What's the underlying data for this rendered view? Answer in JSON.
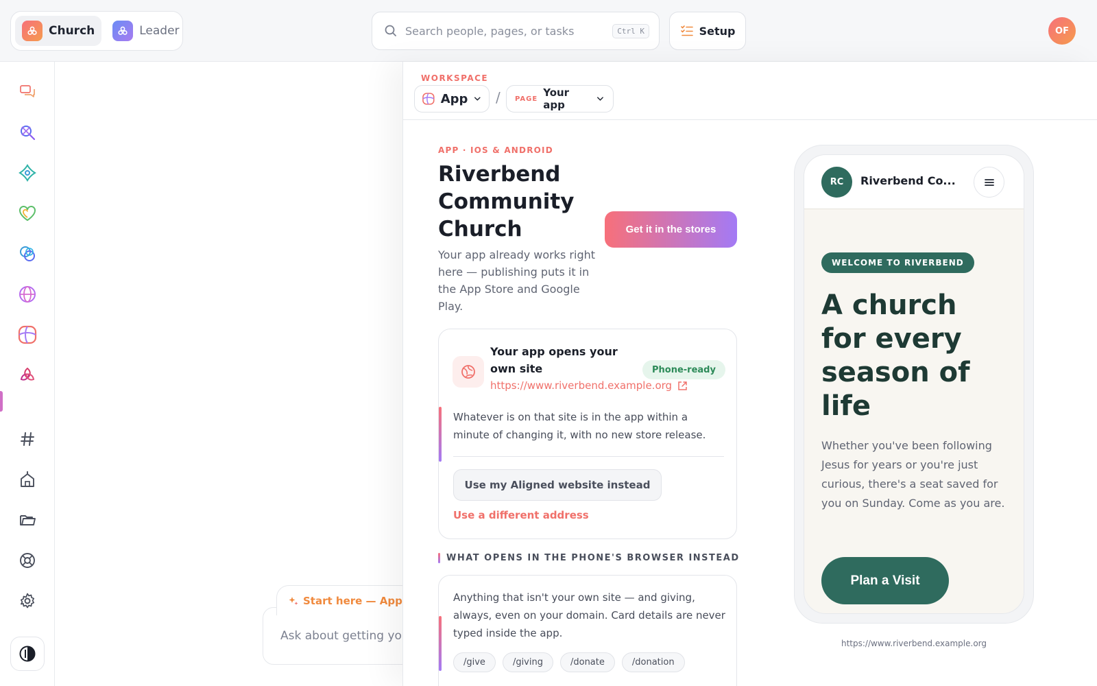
{
  "topbar": {
    "tabs": [
      {
        "label": "Church",
        "active": true
      },
      {
        "label": "Leader",
        "active": false
      }
    ],
    "search": {
      "placeholder": "Search people, pages, or tasks",
      "shortcut": "Ctrl K"
    },
    "setup_label": "Setup",
    "avatar_initials": "OF"
  },
  "sidebar": {
    "icons": [
      "chat-bubbles-icon",
      "people-search-icon",
      "diamond-cross-icon",
      "heart-icon",
      "interlocked-rings-icon",
      "globe-icon",
      "app-grid-icon",
      "triquetra-icon",
      "hash-icon",
      "church-building-icon",
      "folder-icon",
      "lifebuoy-icon",
      "gear-icon",
      "theme-toggle-icon"
    ],
    "active_index": 6
  },
  "chat": {
    "tag": "Start here — App",
    "placeholder": "Ask about getting you"
  },
  "panel": {
    "workspace_label": "WORKSPACE",
    "workspace_value": "App",
    "crumb_sep": "/",
    "page_kicker": "PAGE",
    "page_value": "Your app",
    "kicker": "APP · IOS & ANDROID",
    "title": "Riverbend Community Church",
    "subtitle": "Your app already works right here — publishing puts it in the App Store and Google Play.",
    "stores_button": "Get it in the stores",
    "site_card": {
      "title": "Your app opens your own site",
      "badge": "Phone-ready",
      "url": "https://www.riverbend.example.org",
      "note": "Whatever is on that site is in the app within a minute of changing it, with no new store release.",
      "aligned_button": "Use my Aligned website instead",
      "different_link": "Use a different address"
    },
    "browser_section": {
      "label": "WHAT OPENS IN THE PHONE'S BROWSER INSTEAD",
      "text": "Anything that isn't your own site — and giving, always, even on your domain. Card details are never typed inside the app.",
      "chips": [
        "/give",
        "/giving",
        "/donate",
        "/donation"
      ]
    }
  },
  "phone": {
    "initials": "RC",
    "church_name": "Riverbend Co...",
    "welcome": "WELCOME TO RIVERBEND",
    "hero": "A church for every season of life",
    "body": "Whether you've been following Jesus for years or you're just curious, there's a seat saved for you on Sunday. Come as you are.",
    "cta": "Plan a Visit",
    "url": "https://www.riverbend.example.org"
  },
  "colors": {
    "accent": "#f0706a",
    "brand_green": "#2f6b5e",
    "gradient_start": "#f7707a",
    "gradient_end": "#a37af5"
  }
}
